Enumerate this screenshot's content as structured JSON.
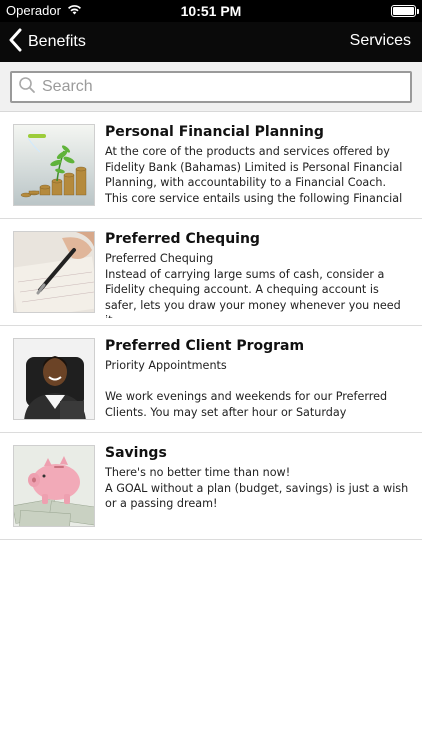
{
  "status_bar": {
    "carrier": "Operador",
    "time": "10:51 PM",
    "icons": {
      "wifi": "wifi-icon",
      "battery": "battery-icon"
    }
  },
  "nav": {
    "back_label": "Benefits",
    "right_label": "Services",
    "back_icon": "chevron-left-icon"
  },
  "search": {
    "placeholder": "Search",
    "value": "",
    "icon": "search-icon"
  },
  "items": [
    {
      "title": "Personal Financial Planning",
      "body": "At the core of the products and services offered by Fidelity Bank (Bahamas) Limited is Personal Financial Planning, with accountability to a Financial Coach. This core service entails using the following Financial",
      "image": "plant-growing-on-coins-image"
    },
    {
      "title": "Preferred Chequing",
      "body": "Preferred Chequing\nInstead of carrying large sums of cash, consider a Fidelity chequing account. A chequing account is safer, lets you draw your money whenever you need it,",
      "image": "hand-writing-cheque-image"
    },
    {
      "title": "Preferred Client Program",
      "body": "Priority Appointments\n\nWe work evenings and weekends for our Preferred Clients. You may set after hour or Saturday",
      "image": "smiling-businesswoman-image"
    },
    {
      "title": "Savings",
      "body": "There's no better time than now!\nA GOAL without a plan (budget, savings) is just a wish or a passing dream!",
      "image": "piggy-bank-on-money-image"
    }
  ]
}
